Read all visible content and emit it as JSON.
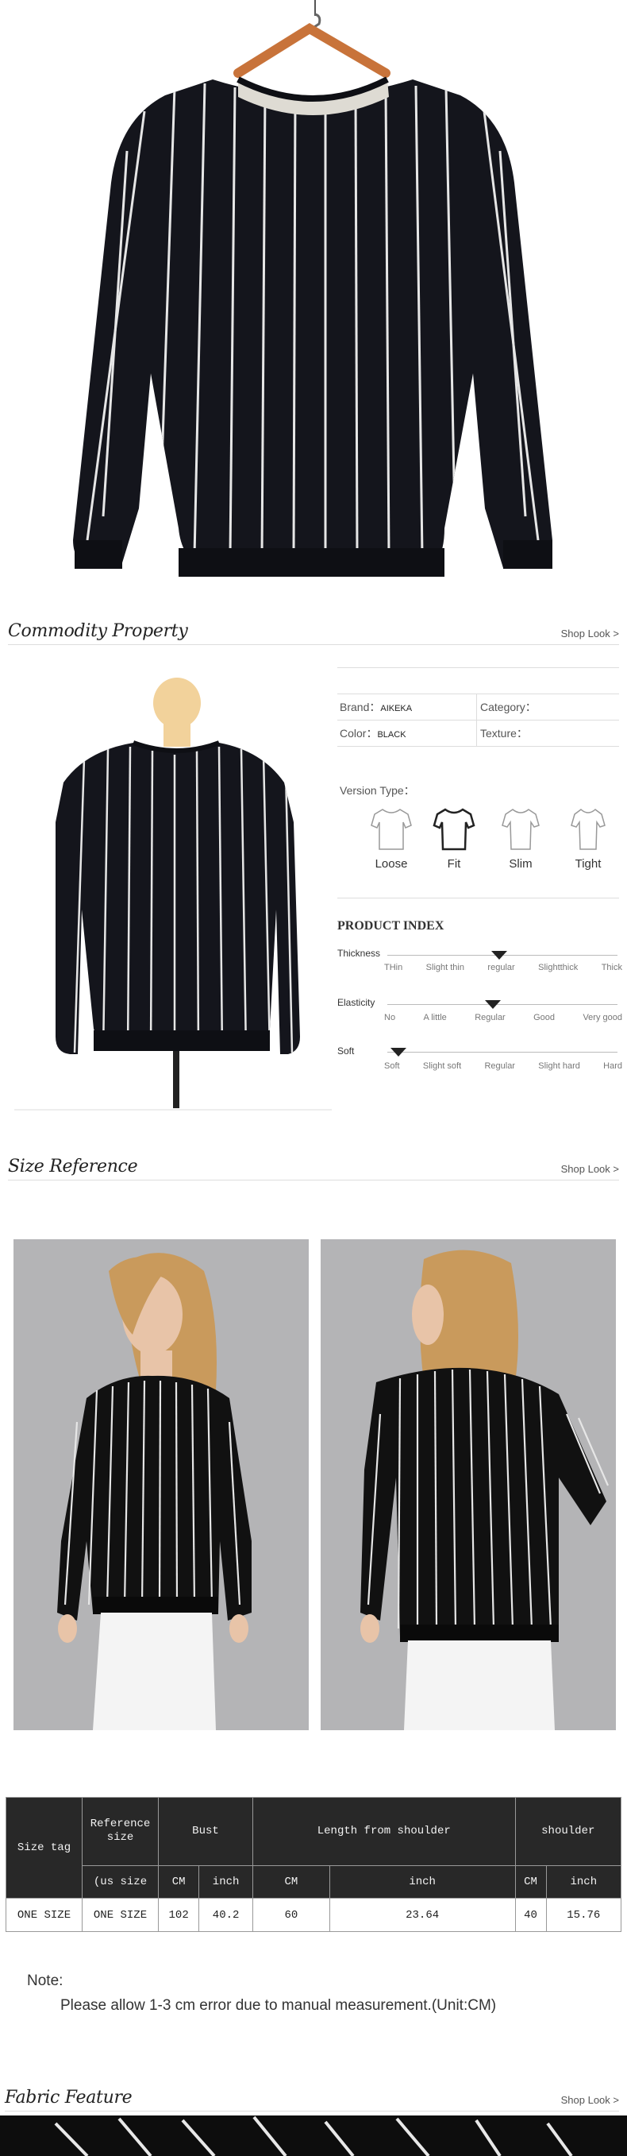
{
  "sections": {
    "commodity": {
      "title": "Commodity Property",
      "link": "Shop Look >"
    },
    "size": {
      "title": "Size Reference",
      "link": "Shop Look >"
    },
    "fabric": {
      "title": "Fabric Feature",
      "link": "Shop Look >"
    }
  },
  "property": {
    "brand_label": "Brand：",
    "brand_value": "AIKEKA",
    "category_label": "Category：",
    "color_label": "Color：",
    "color_value": "BLACK",
    "texture_label": "Texture："
  },
  "version_type": {
    "label": "Version Type：",
    "options": [
      "Loose",
      "Fit",
      "Slim",
      "Tight"
    ],
    "selected": "Fit"
  },
  "product_index": {
    "title": "PRODUCT INDEX",
    "rows": [
      {
        "label": "Thickness",
        "ticks": [
          "THin",
          "Slight thin",
          "regular",
          "Slightthick",
          "Thick"
        ],
        "level": 2
      },
      {
        "label": "Elasticity",
        "ticks": [
          "No",
          "A little",
          "Regular",
          "Good",
          "Very good"
        ],
        "level": 2
      },
      {
        "label": "Soft",
        "ticks": [
          "Soft",
          "Slight soft",
          "Regular",
          "Slight hard",
          "Hard"
        ],
        "level": 0
      }
    ]
  },
  "size_table": {
    "header_size_tag": "Size tag",
    "header_reference": "Reference size",
    "header_us": "(us size",
    "header_bust": "Bust",
    "header_length": "Length from shoulder",
    "header_shoulder": "shoulder",
    "unit_cm": "CM",
    "unit_inch": "inch",
    "row": [
      "ONE SIZE",
      "ONE SIZE",
      "102",
      "40.2",
      "60",
      "23.64",
      "40",
      "15.76"
    ]
  },
  "note": {
    "title": "Note:",
    "text": "Please allow 1-3 cm error due to manual measurement.(Unit:CM)"
  },
  "colors": {
    "sweater": "#14151c",
    "stripe": "#e6e6e6",
    "hanger": "#c8733a",
    "photo_bg": "#b4b4b6"
  }
}
